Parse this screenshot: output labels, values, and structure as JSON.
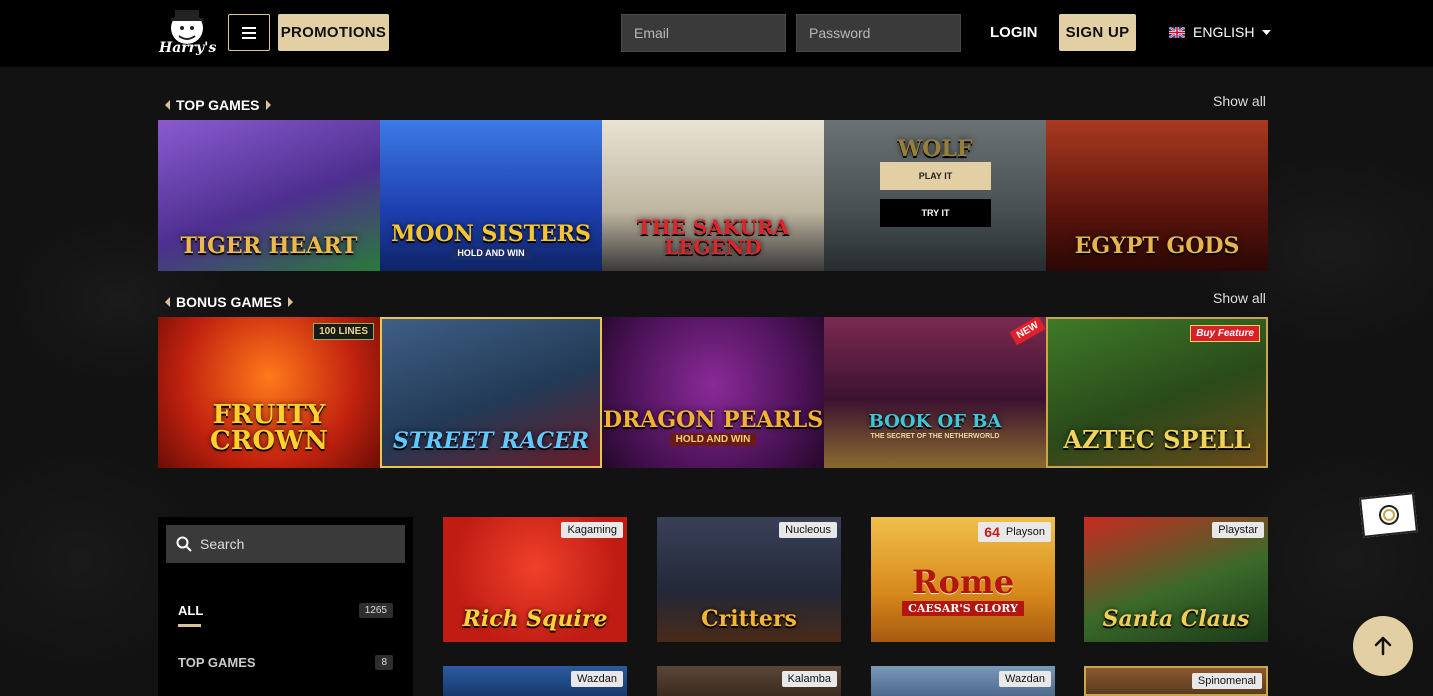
{
  "header": {
    "logo_text": "Harry's",
    "promotions_label": "PROMOTIONS",
    "email_placeholder": "Email",
    "password_placeholder": "Password",
    "login_label": "LOGIN",
    "signup_label": "SIGN UP",
    "language_label": "ENGLISH"
  },
  "sections": {
    "top_games": {
      "title": "TOP GAMES",
      "show_all": "Show all",
      "games": [
        {
          "name": "Tiger Heart",
          "bg": "#6a3fa8",
          "accent": "#e0a53a"
        },
        {
          "name": "Moon Sisters",
          "sub": "HOLD AND WIN",
          "bg": "#1d4fc4",
          "accent": "#f5c030"
        },
        {
          "name": "The Sakura Legend",
          "bg": "#d9d4c8",
          "accent": "#d8202a"
        },
        {
          "name": "Wolf",
          "bg": "#7d8a8e",
          "accent": "#e8c45a",
          "play_label": "PLAY IT",
          "try_label": "TRY IT"
        },
        {
          "name": "Egypt Gods",
          "bg": "#7a1f14",
          "accent": "#e7b54a"
        }
      ]
    },
    "bonus_games": {
      "title": "BONUS GAMES",
      "show_all": "Show all",
      "games": [
        {
          "name": "Fruity Crown",
          "badge": "100 LINES",
          "bg": "#c2220f",
          "accent": "#ffcf2e"
        },
        {
          "name": "Street Racer",
          "bg": "#2a4a6e",
          "accent": "#5fc6ff"
        },
        {
          "name": "Dragon Pearls",
          "sub": "HOLD AND WIN",
          "bg": "#5a1a64",
          "accent": "#f0b030"
        },
        {
          "name": "Book of Ba",
          "sub": "THE SECRET OF THE NETHERWORLD",
          "badge": "NEW",
          "bg": "#4a1a3c",
          "accent": "#3ec5d8"
        },
        {
          "name": "Aztec Spell",
          "badge": "Buy Feature",
          "bg": "#2f5a1e",
          "accent": "#f1d35a"
        }
      ]
    }
  },
  "sidebar": {
    "search_placeholder": "Search",
    "categories": [
      {
        "label": "ALL",
        "count": "1265"
      },
      {
        "label": "TOP GAMES",
        "count": "8"
      }
    ]
  },
  "grid": [
    {
      "name": "Rich Squire",
      "provider": "Kagaming",
      "bg": "#d8241e",
      "accent": "#ffd23a"
    },
    {
      "name": "Critters",
      "provider": "Nucleous",
      "bg": "#2a2f44",
      "accent": "#f4b530"
    },
    {
      "name": "Rome",
      "sub": "CAESAR'S GLORY",
      "provider": "Playson",
      "extra": "64",
      "bg": "#e2a02a",
      "accent": "#b3160f"
    },
    {
      "name": "Santa Claus",
      "provider": "Playstar",
      "bg": "#2c5a28",
      "accent": "#f0cc58"
    },
    {
      "name": "",
      "provider": "Wazdan",
      "bg": "#173a6e",
      "accent": "#ffffff"
    },
    {
      "name": "",
      "provider": "Kalamba",
      "bg": "#3a2b20",
      "accent": "#ffffff"
    },
    {
      "name": "",
      "provider": "Wazdan",
      "bg": "#4c6a8c",
      "accent": "#ffffff"
    },
    {
      "name": "",
      "provider": "Spinomenal",
      "bg": "#5a3a20",
      "accent": "#ffffff"
    }
  ],
  "icons": {
    "menu": "hamburger-icon",
    "search": "search-icon",
    "scroll_top": "arrow-up-icon",
    "flag": "uk-flag-icon"
  },
  "colors": {
    "gold": "#e3cfa4",
    "background": "#121212",
    "header": "#000000"
  }
}
